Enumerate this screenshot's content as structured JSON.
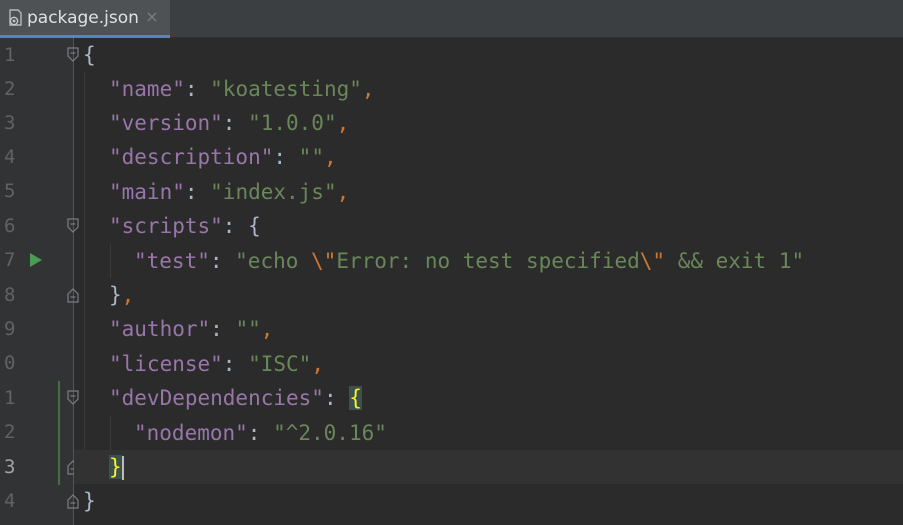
{
  "tab": {
    "title": "package.json",
    "close_glyph": "×",
    "icon": "package-json-file-icon"
  },
  "line_numbers": [
    "1",
    "2",
    "3",
    "4",
    "5",
    "6",
    "7",
    "8",
    "9",
    "0",
    "1",
    "2",
    "3",
    "4"
  ],
  "code": {
    "l1": {
      "brace": "{"
    },
    "l2": {
      "key": "\"name\"",
      "colon": ": ",
      "value": "\"koatesting\"",
      "comma": ","
    },
    "l3": {
      "key": "\"version\"",
      "colon": ": ",
      "value": "\"1.0.0\"",
      "comma": ","
    },
    "l4": {
      "key": "\"description\"",
      "colon": ": ",
      "value": "\"\"",
      "comma": ","
    },
    "l5": {
      "key": "\"main\"",
      "colon": ": ",
      "value": "\"index.js\"",
      "comma": ","
    },
    "l6": {
      "key": "\"scripts\"",
      "colon": ": ",
      "brace": "{"
    },
    "l7": {
      "key": "\"test\"",
      "colon": ": ",
      "value_a": "\"echo ",
      "esc1": "\\\"",
      "value_b": "Error: no test specified",
      "esc2": "\\\"",
      "value_c": " && exit 1\""
    },
    "l8": {
      "brace": "}",
      "comma": ","
    },
    "l9": {
      "key": "\"author\"",
      "colon": ": ",
      "value": "\"\"",
      "comma": ","
    },
    "l10": {
      "key": "\"license\"",
      "colon": ": ",
      "value": "\"ISC\"",
      "comma": ","
    },
    "l11": {
      "key": "\"devDependencies\"",
      "colon": ": ",
      "brace": "{"
    },
    "l12": {
      "key": "\"nodemon\"",
      "colon": ": ",
      "value": "\"^2.0.16\""
    },
    "l13": {
      "brace": "}"
    },
    "l14": {
      "brace": "}"
    }
  },
  "colors": {
    "background": "#2b2b2b",
    "gutter": "#313335",
    "key": "#9876aa",
    "string": "#6a8759",
    "punctuation": "#cc7832",
    "brace_match": "#ffef28",
    "run_icon": "#499c54",
    "tab_underline": "#4a88c7"
  }
}
